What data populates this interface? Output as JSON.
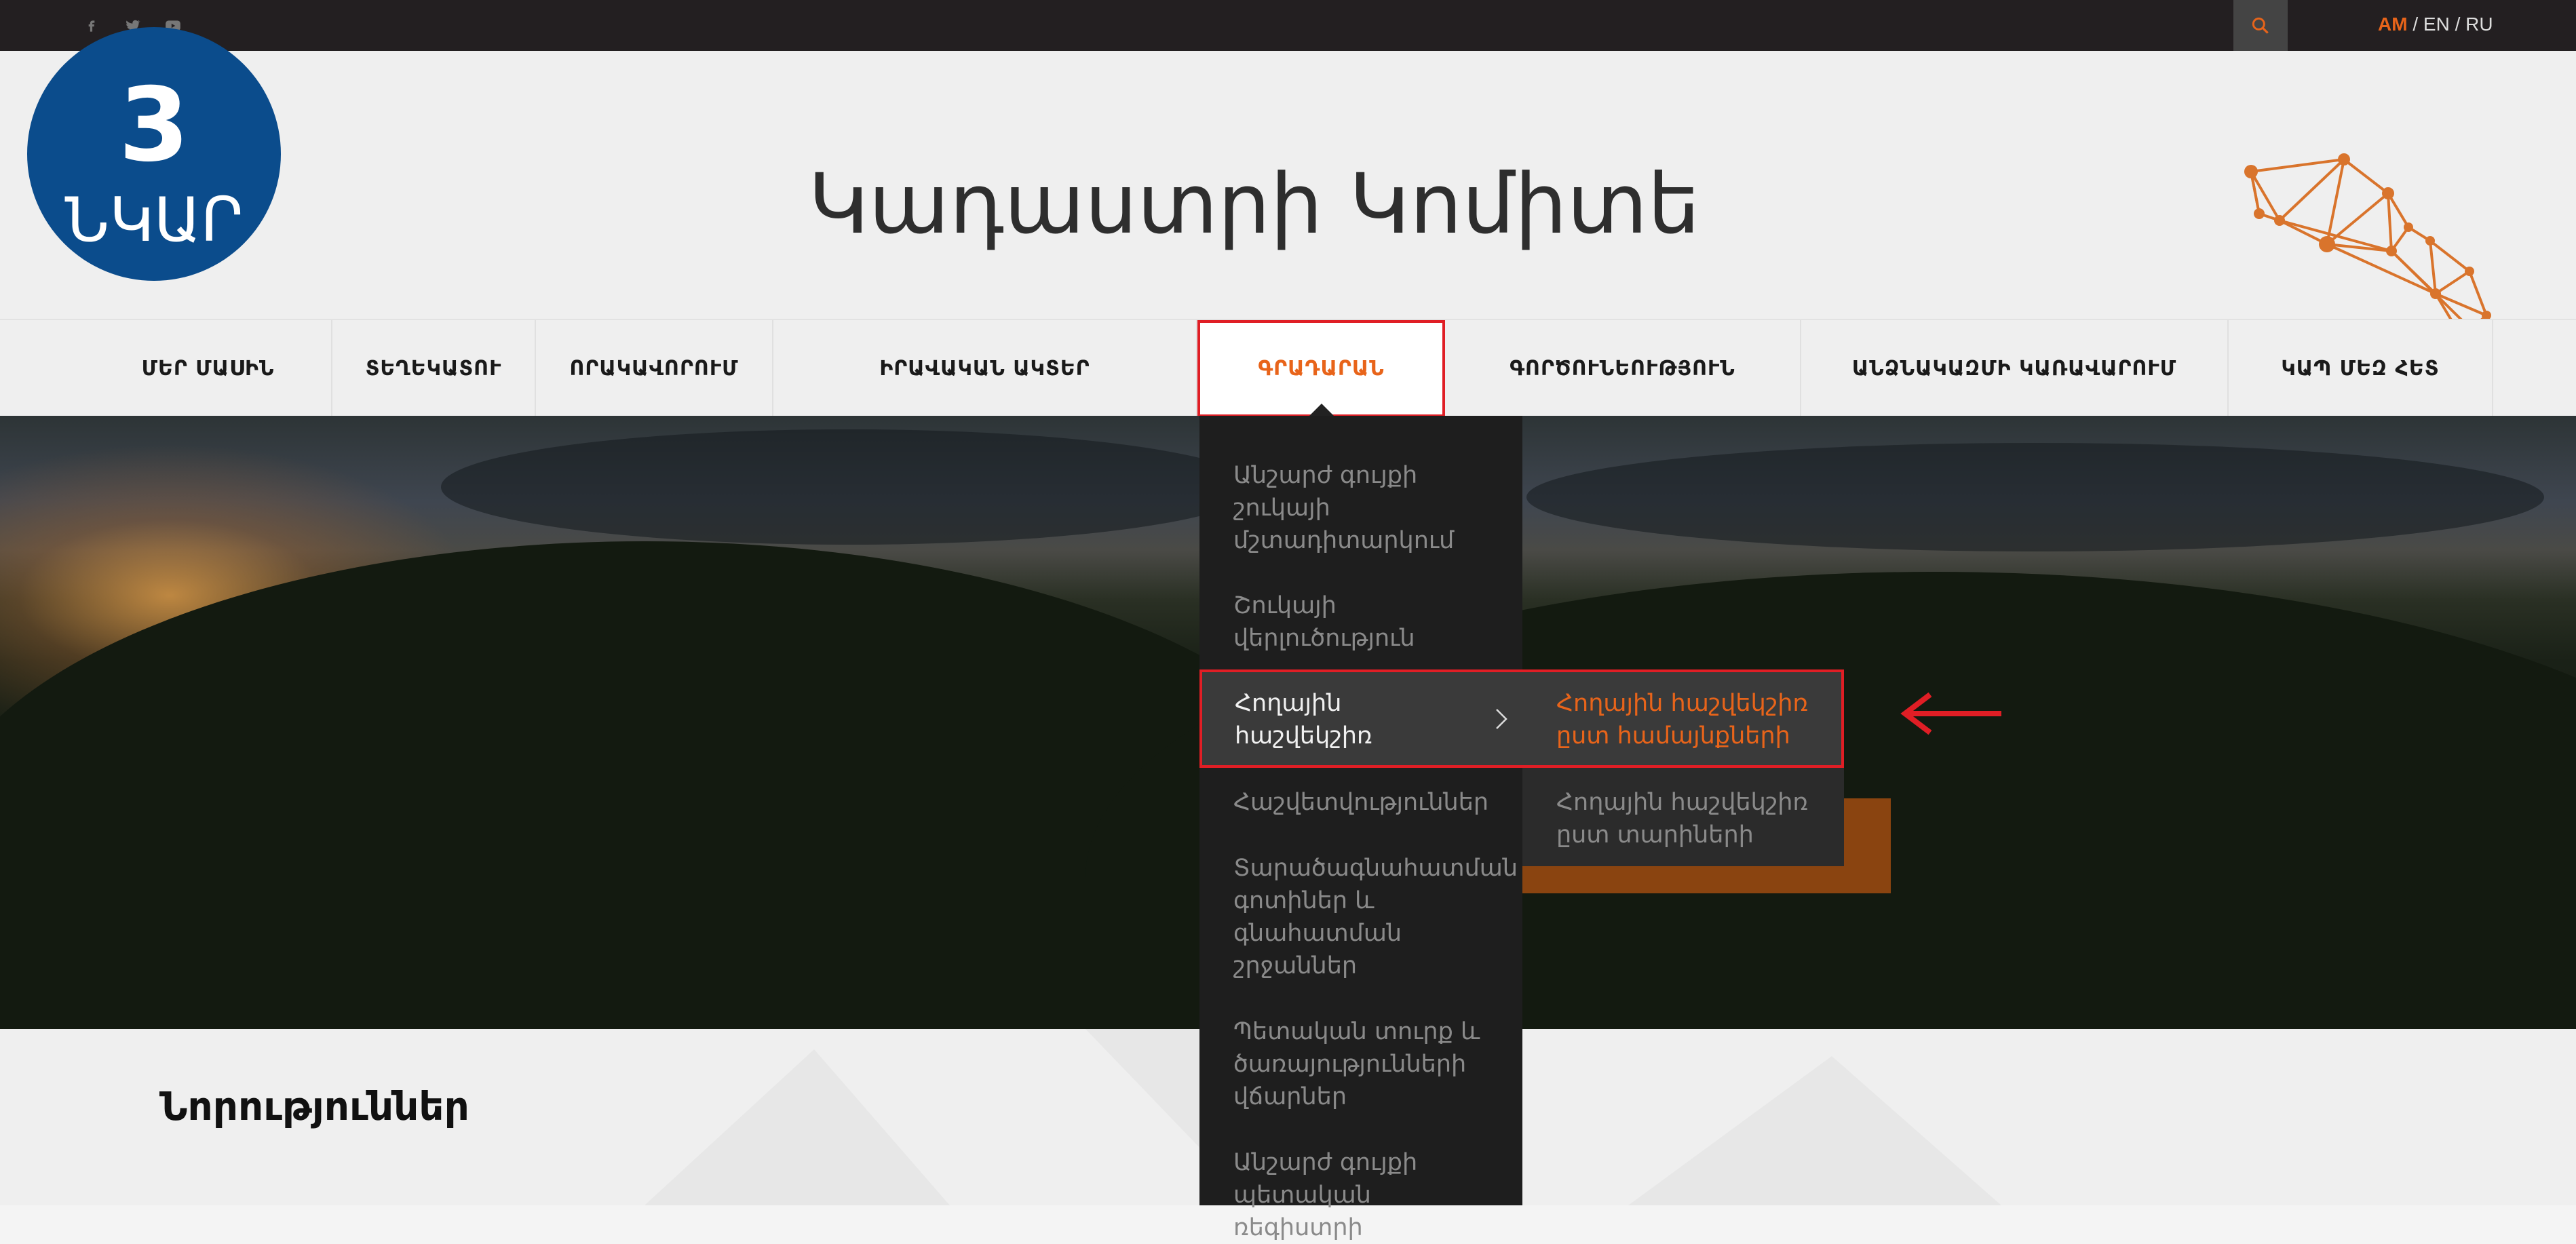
{
  "topbar": {
    "social": [
      "facebook-icon",
      "twitter-icon",
      "youtube-icon"
    ],
    "languages": {
      "active": "AM",
      "sep1": " / ",
      "en": "EN",
      "sep2": " / ",
      "ru": "RU"
    }
  },
  "badge": {
    "number": "3",
    "label": "ՆԿԱՐ"
  },
  "header": {
    "title": "Կադաստրի Կոմիտե"
  },
  "nav": {
    "items": [
      "ՄԵՐ ՄԱՍԻՆ",
      "ՏԵՂԵԿԱՏՈՒ",
      "ՈՐԱԿԱՎՈՐՈՒՄ",
      "ԻՐԱՎԱԿԱՆ ԱԿՏԵՐ",
      "ԳՐԱԴԱՐԱՆ",
      "ԳՈՐԾՈՒՆԵՈՒԹՅՈՒՆ",
      "ԱՆՁՆԱԿԱԶՄԻ ԿԱՌԱՎԱՐՈՒՄ",
      "ԿԱՊ ՄԵԶ ՀԵՏ"
    ],
    "active_index": 4
  },
  "dropdown": {
    "items": [
      "Անշարժ գույքի շուկայի մշտադիտարկում",
      "Շուկայի վերլուծություն",
      "Հողային հաշվեկշիռ",
      "Հաշվետվություններ",
      "Տարածագնահատման գոտիներ և գնահատման շրջաններ",
      "Պետական տուրք և ծառայությունների վճարներ",
      "Անշարժ գույքի պետական ռեգիստրի"
    ],
    "highlighted_index": 2,
    "submenu": [
      "Հողային հաշվեկշիռ ըստ համայնքների",
      "Հողային հաշվեկշիռ ըստ տարիների"
    ]
  },
  "news": {
    "title": "Նորություններ"
  },
  "colors": {
    "accent": "#e8641a",
    "highlight_border": "#e01e25",
    "badge": "#0b4c8c"
  }
}
